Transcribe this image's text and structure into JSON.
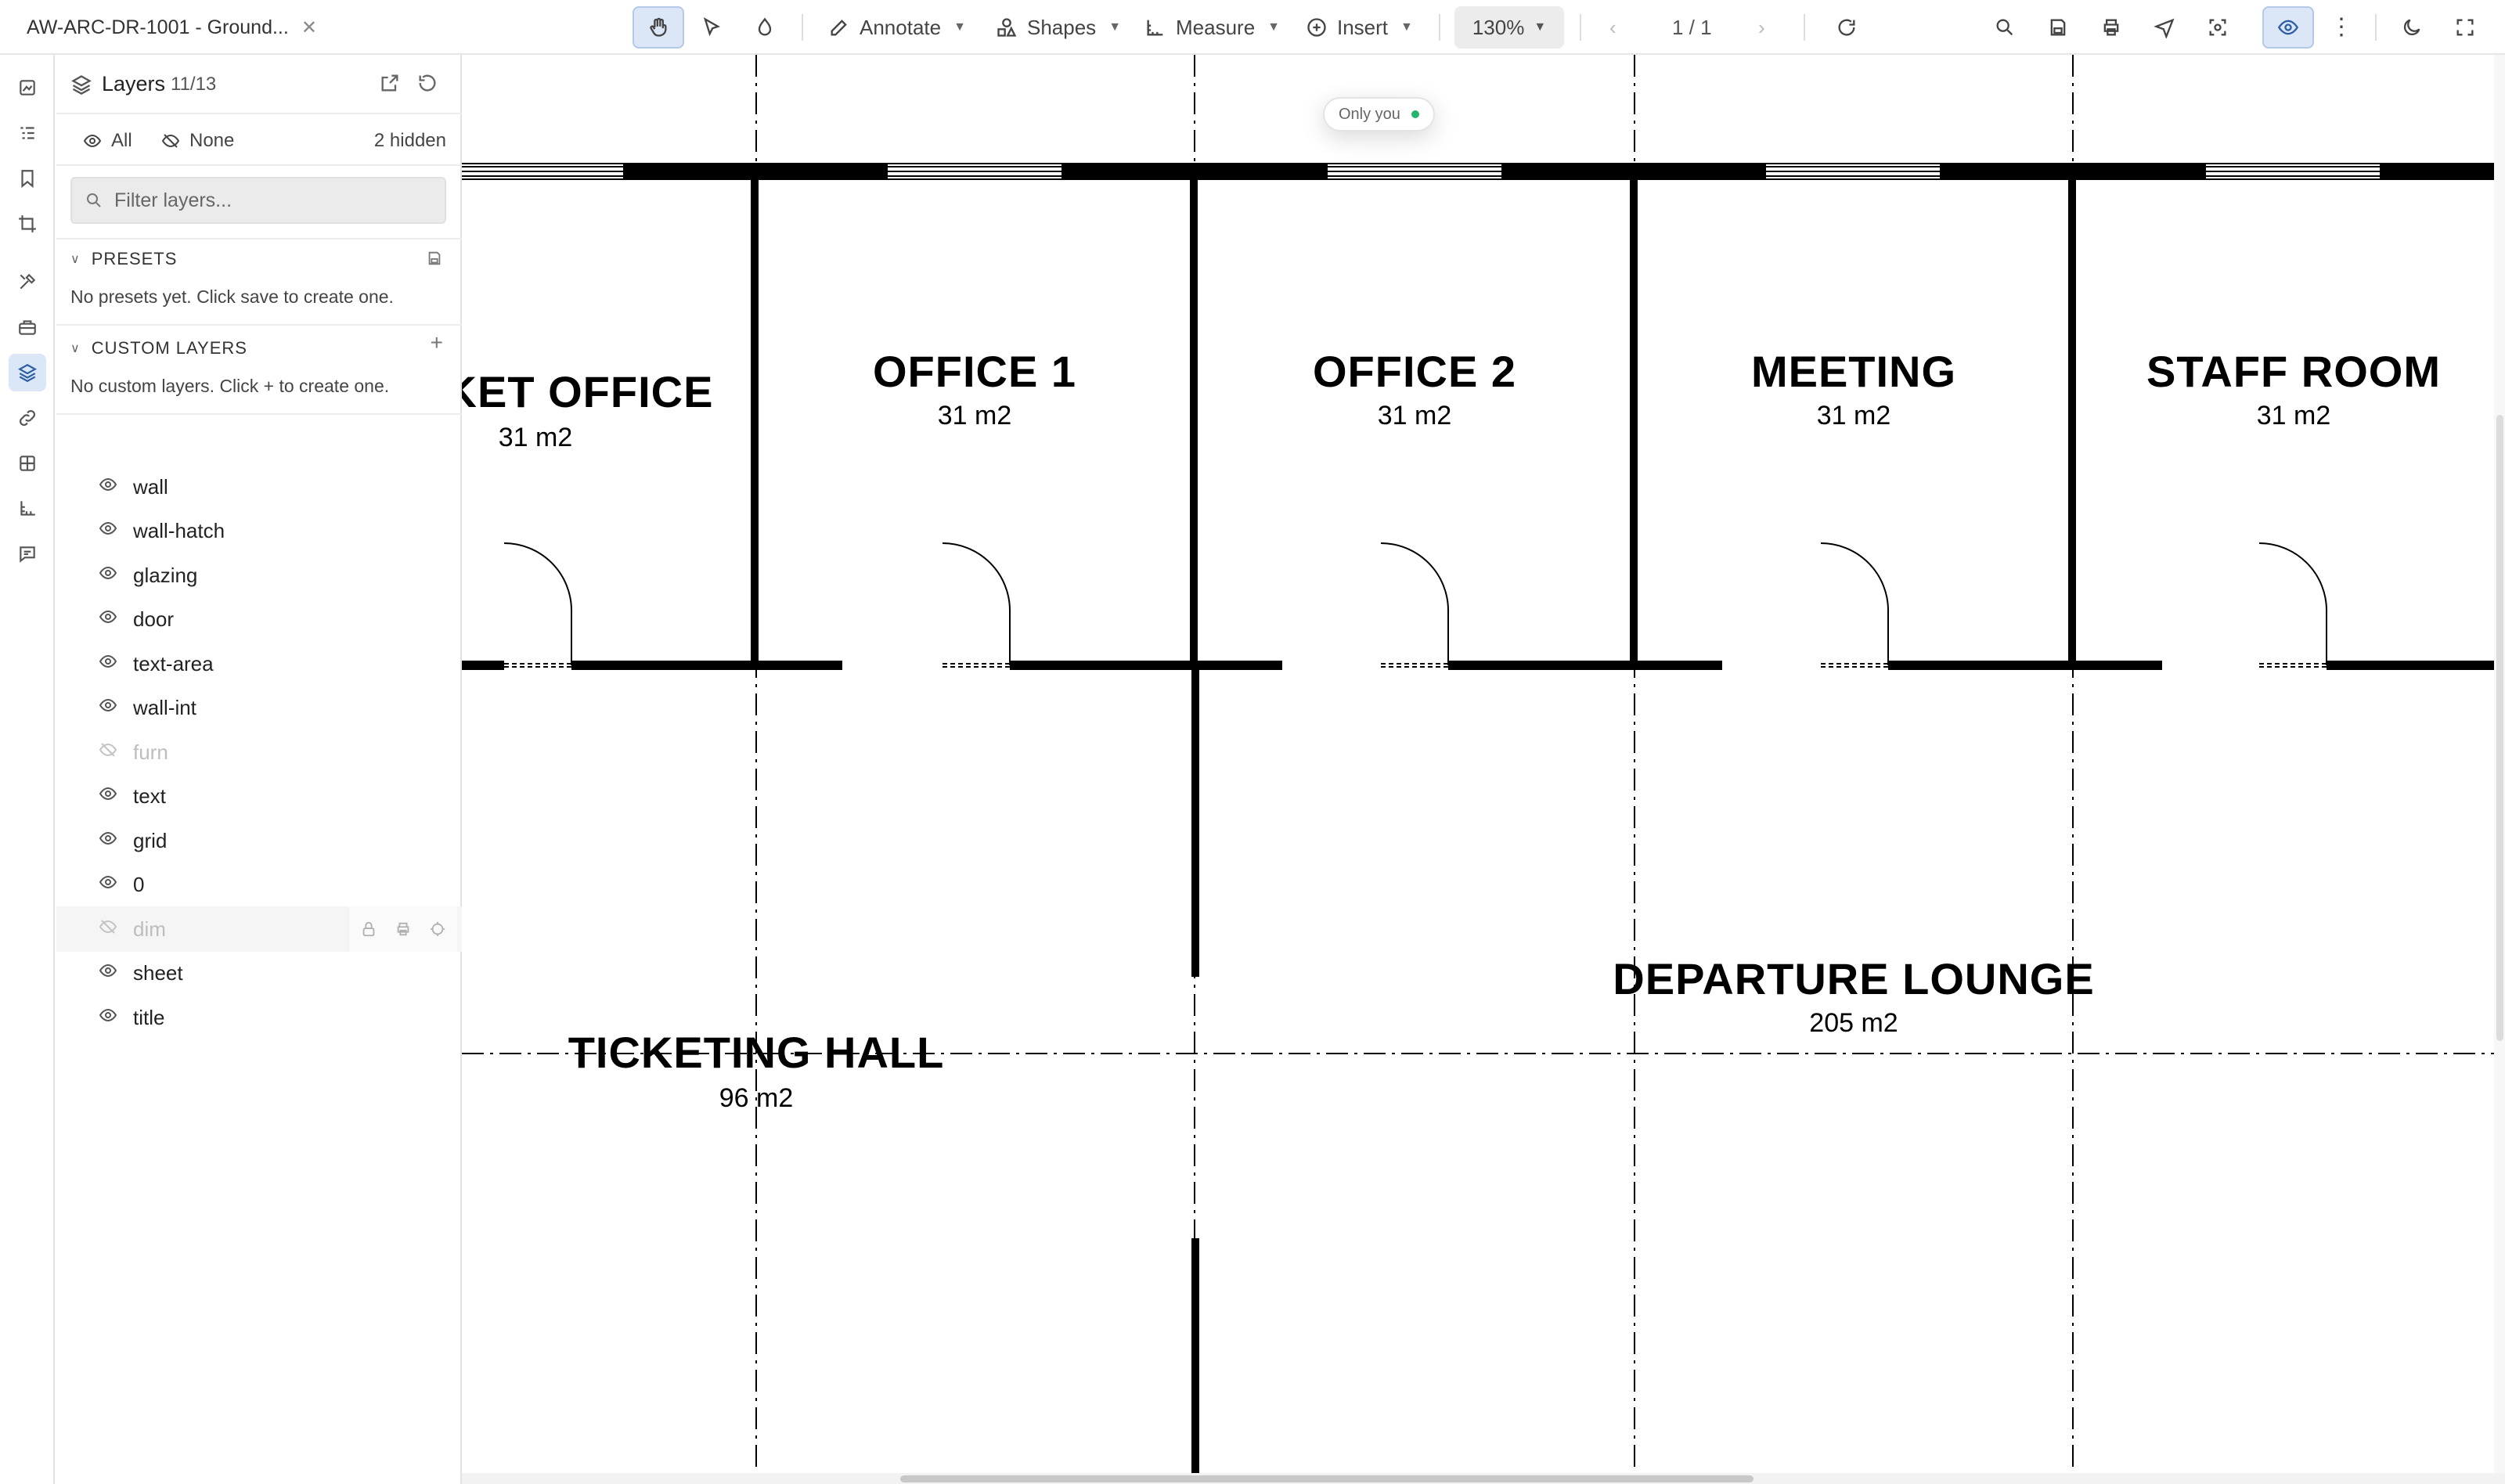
{
  "document": {
    "tab_title": "AW-ARC-DR-1001 - Ground...",
    "close_icon": "close-icon"
  },
  "toolbar": {
    "pan_tool": "hand-icon",
    "select_tool": "pointer-icon",
    "ink_tool": "drop-icon",
    "annotate_label": "Annotate",
    "shapes_label": "Shapes",
    "measure_label": "Measure",
    "insert_label": "Insert",
    "zoom_value": "130%",
    "page_indicator": "1 / 1",
    "right_icons": [
      "search-icon",
      "save-icon",
      "print-icon",
      "send-icon",
      "fit-screen-icon",
      "eye-icon",
      "more-icon",
      "moon-icon",
      "fullscreen-icon"
    ]
  },
  "rail": {
    "icons": [
      "thumbnails-icon",
      "outline-icon",
      "bookmark-icon",
      "crop-icon",
      "tools-icon",
      "stamp-icon",
      "layers-icon",
      "link-icon",
      "grid-icon",
      "measure-icon",
      "comment-icon"
    ]
  },
  "layers_panel": {
    "title": "Layers",
    "count": "11/13",
    "all_label": "All",
    "none_label": "None",
    "hidden_count": "2 hidden",
    "filter_placeholder": "Filter layers...",
    "presets_title": "PRESETS",
    "presets_empty": "No presets yet. Click save to create one.",
    "custom_title": "CUSTOM LAYERS",
    "custom_add": "+",
    "custom_empty": "No custom layers. Click + to create one.",
    "layers": [
      {
        "name": "wall",
        "visible": true
      },
      {
        "name": "wall-hatch",
        "visible": true
      },
      {
        "name": "glazing",
        "visible": true
      },
      {
        "name": "door",
        "visible": true
      },
      {
        "name": "text-area",
        "visible": true
      },
      {
        "name": "wall-int",
        "visible": true
      },
      {
        "name": "furn",
        "visible": false
      },
      {
        "name": "text",
        "visible": true
      },
      {
        "name": "grid",
        "visible": true
      },
      {
        "name": "0",
        "visible": true
      },
      {
        "name": "dim",
        "visible": false
      },
      {
        "name": "sheet",
        "visible": true
      },
      {
        "name": "title",
        "visible": true
      }
    ]
  },
  "presence": {
    "label": "Only you",
    "status_color": "#22b46a"
  },
  "rooms": [
    {
      "name": "KET OFFICE",
      "area": "31 m2"
    },
    {
      "name": "OFFICE 1",
      "area": "31 m2"
    },
    {
      "name": "OFFICE 2",
      "area": "31 m2"
    },
    {
      "name": "MEETING",
      "area": "31 m2"
    },
    {
      "name": "STAFF ROOM",
      "area": "31 m2"
    },
    {
      "name": "DEPARTURE LOUNGE",
      "area": "205 m2"
    },
    {
      "name": "TICKETING HALL",
      "area": "96 m2"
    }
  ],
  "colors": {
    "accent": "#2d5fa8",
    "active_bg": "#dbe6f6"
  }
}
